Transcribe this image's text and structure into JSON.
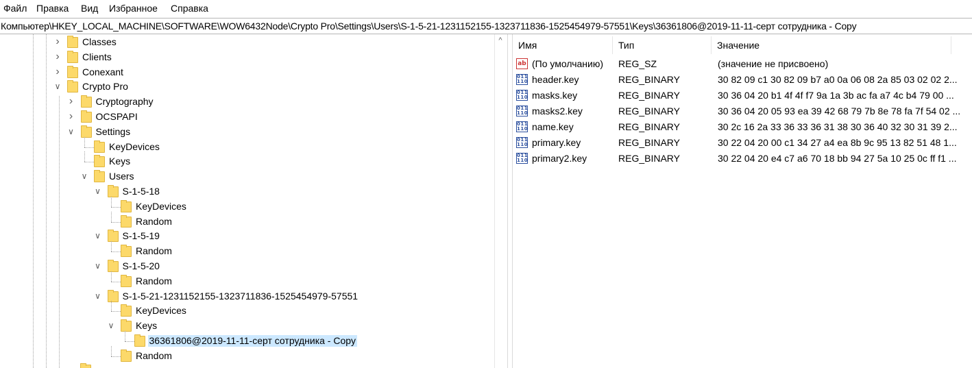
{
  "menu": [
    "Файл",
    "Правка",
    "Вид",
    "Избранное",
    "Справка"
  ],
  "address": "Компьютер\\HKEY_LOCAL_MACHINE\\SOFTWARE\\WOW6432Node\\Crypto Pro\\Settings\\Users\\S-1-5-21-1231152155-1323711836-1525454979-57551\\Keys\\36361806@2019-11-11-серт сотрудника - Copy",
  "tree": [
    {
      "label": "Classes",
      "expander": "collapsed",
      "selected": false
    },
    {
      "label": "Clients",
      "expander": "collapsed",
      "selected": false
    },
    {
      "label": "Conexant",
      "expander": "collapsed",
      "selected": false
    },
    {
      "label": "Crypto Pro",
      "expander": "expanded",
      "selected": false
    },
    {
      "label": "Cryptography",
      "expander": "collapsed",
      "selected": false
    },
    {
      "label": "OCSPAPI",
      "expander": "collapsed",
      "selected": false
    },
    {
      "label": "Settings",
      "expander": "expanded",
      "selected": false
    },
    {
      "label": "KeyDevices",
      "expander": "none",
      "selected": false
    },
    {
      "label": "Keys",
      "expander": "none",
      "selected": false
    },
    {
      "label": "Users",
      "expander": "expanded",
      "selected": false
    },
    {
      "label": "S-1-5-18",
      "expander": "expanded",
      "selected": false
    },
    {
      "label": "KeyDevices",
      "expander": "none",
      "selected": false
    },
    {
      "label": "Random",
      "expander": "none",
      "selected": false
    },
    {
      "label": "S-1-5-19",
      "expander": "expanded",
      "selected": false
    },
    {
      "label": "Random",
      "expander": "none",
      "selected": false
    },
    {
      "label": "S-1-5-20",
      "expander": "expanded",
      "selected": false
    },
    {
      "label": "Random",
      "expander": "none",
      "selected": false
    },
    {
      "label": "S-1-5-21-1231152155-1323711836-1525454979-57551",
      "expander": "expanded",
      "selected": false
    },
    {
      "label": "KeyDevices",
      "expander": "none",
      "selected": false
    },
    {
      "label": "Keys",
      "expander": "expanded",
      "selected": false
    },
    {
      "label": "36361806@2019-11-11-серт сотрудника - Copy",
      "expander": "none",
      "selected": true
    },
    {
      "label": "Random",
      "expander": "none",
      "selected": false
    }
  ],
  "columns": {
    "name": "Имя",
    "type": "Тип",
    "value": "Значение"
  },
  "values": [
    {
      "name": "(По умолчанию)",
      "type": "REG_SZ",
      "data": "(значение не присвоено)",
      "icon": "string-value-icon"
    },
    {
      "name": "header.key",
      "type": "REG_BINARY",
      "data": "30 82 09 c1 30 82 09 b7 a0 0a 06 08 2a 85 03 02 02 2...",
      "icon": "binary-value-icon"
    },
    {
      "name": "masks.key",
      "type": "REG_BINARY",
      "data": "30 36 04 20 b1 4f 4f f7 9a 1a 3b ac fa a7 4c b4 79 00 ...",
      "icon": "binary-value-icon"
    },
    {
      "name": "masks2.key",
      "type": "REG_BINARY",
      "data": "30 36 04 20 05 93 ea 39 42 68 79 7b 8e 78 fa 7f 54 02 ...",
      "icon": "binary-value-icon"
    },
    {
      "name": "name.key",
      "type": "REG_BINARY",
      "data": "30 2c 16 2a 33 36 33 36 31 38 30 36 40 32 30 31 39 2...",
      "icon": "binary-value-icon"
    },
    {
      "name": "primary.key",
      "type": "REG_BINARY",
      "data": "30 22 04 20 00 c1 34 27 a4 ea 8b 9c 95 13 82 51 48 1...",
      "icon": "binary-value-icon"
    },
    {
      "name": "primary2.key",
      "type": "REG_BINARY",
      "data": "30 22 04 20 e4 c7 a6 70 18 bb 94 27 5a 10 25 0c ff f1 ...",
      "icon": "binary-value-icon"
    }
  ],
  "icons": {
    "string_value_glyph": "ab",
    "binary_value_glyph": "011\n110"
  },
  "colors": {
    "selection": "#cce8ff",
    "folder": "#fcd96a"
  }
}
